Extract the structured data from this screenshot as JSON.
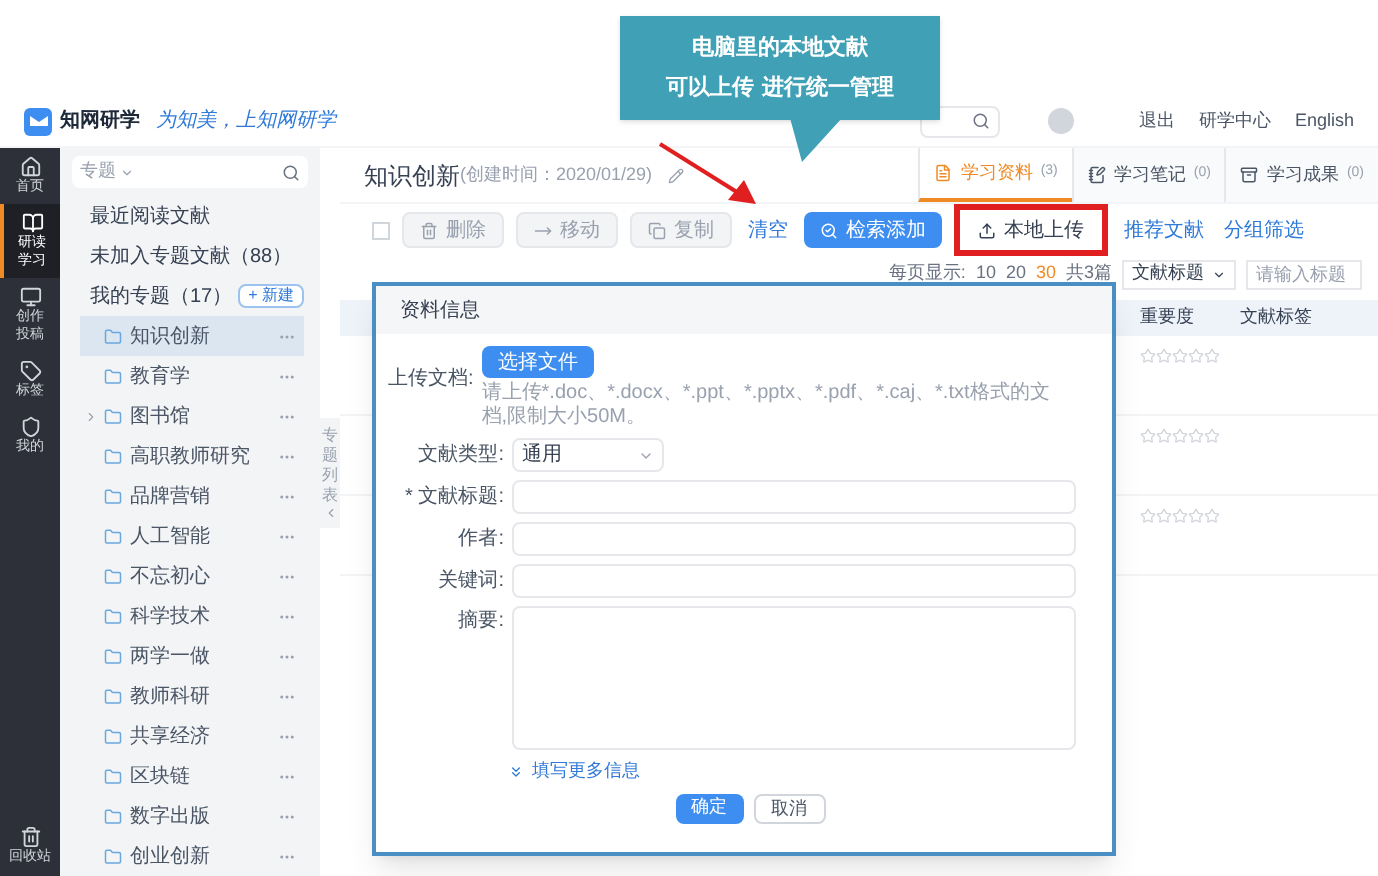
{
  "callout": {
    "lines": [
      "电脑里的本地文献",
      "可以上传 进行统一管理"
    ]
  },
  "topbar": {
    "app_name": "知网研学",
    "slogan": "为知美，上知网研学",
    "links": [
      "退出",
      "研学中心",
      "English"
    ]
  },
  "nav": [
    {
      "label": "首页",
      "selected": false
    },
    {
      "label": "研读学习",
      "selected": true
    },
    {
      "label": "创作投稿",
      "selected": false
    },
    {
      "label": "标签",
      "selected": false
    },
    {
      "label": "我的",
      "selected": false
    }
  ],
  "trash_nav": "回收站",
  "sidebar": {
    "filter": "专题",
    "links": [
      "最近阅读文献",
      "未加入专题文献（88）"
    ],
    "my_topics": "我的专题（17）",
    "new_button": "+ 新建",
    "folders": [
      {
        "label": "知识创新",
        "selected": true,
        "expandable": false
      },
      {
        "label": "教育学",
        "selected": false,
        "expandable": false
      },
      {
        "label": "图书馆",
        "selected": false,
        "expandable": true
      },
      {
        "label": "高职教师研究",
        "selected": false,
        "expandable": false
      },
      {
        "label": "品牌营销",
        "selected": false,
        "expandable": false
      },
      {
        "label": "人工智能",
        "selected": false,
        "expandable": false
      },
      {
        "label": "不忘初心",
        "selected": false,
        "expandable": false
      },
      {
        "label": "科学技术",
        "selected": false,
        "expandable": false
      },
      {
        "label": "两学一做",
        "selected": false,
        "expandable": false
      },
      {
        "label": "教师科研",
        "selected": false,
        "expandable": false
      },
      {
        "label": "共享经济",
        "selected": false,
        "expandable": false
      },
      {
        "label": "区块链",
        "selected": false,
        "expandable": false
      },
      {
        "label": "数字出版",
        "selected": false,
        "expandable": false
      },
      {
        "label": "创业创新",
        "selected": false,
        "expandable": false
      }
    ],
    "collapse_tab": "专题列表"
  },
  "main": {
    "title": "知识创新",
    "created": "(创建时间：2020/01/29)",
    "tabs": [
      {
        "label": "学习资料",
        "count": "(3)",
        "selected": true
      },
      {
        "label": "学习笔记",
        "count": "(0)",
        "selected": false
      },
      {
        "label": "学习成果",
        "count": "(0)",
        "selected": false
      }
    ],
    "select_all_checked": false,
    "toolbar": [
      {
        "kind": "button",
        "label": "删除",
        "disabled": true
      },
      {
        "kind": "button",
        "label": "移动",
        "disabled": true
      },
      {
        "kind": "button",
        "label": "复制",
        "disabled": true
      },
      {
        "kind": "link",
        "label": "清空"
      },
      {
        "kind": "primary",
        "label": "检索添加"
      },
      {
        "kind": "upload",
        "label": "本地上传",
        "highlighted": true
      },
      {
        "kind": "link",
        "label": "推荐文献"
      },
      {
        "kind": "link",
        "label": "分组筛选"
      }
    ],
    "paging": {
      "label": "每页显示:",
      "sizes": [
        {
          "label": "10",
          "selected": false
        },
        {
          "label": "20",
          "selected": false
        },
        {
          "label": "30",
          "selected": true
        }
      ],
      "total": "共3篇",
      "field_select": "文献标题",
      "search": {
        "placeholder": "请输入标题"
      }
    },
    "table": {
      "columns": [
        "重要度",
        "文献标签"
      ],
      "rows": [
        {
          "stars": 0
        },
        {
          "stars": 0
        },
        {
          "stars": 0
        }
      ]
    }
  },
  "dialog": {
    "title": "资料信息",
    "fields": [
      {
        "kind": "file",
        "label": "上传文档:",
        "button": "选择文件",
        "hint": "请上传*.doc、*.docx、*.ppt、*.pptx、*.pdf、*.caj、*.txt格式的文档,限制大小50M。"
      },
      {
        "kind": "select",
        "label": "文献类型:",
        "value": "通用"
      },
      {
        "kind": "input",
        "label": "* 文献标题:"
      },
      {
        "kind": "input",
        "label": "作者:"
      },
      {
        "kind": "input",
        "label": "关键词:"
      },
      {
        "kind": "textarea",
        "label": "摘要:"
      }
    ],
    "more_link": "填写更多信息",
    "buttons": [
      {
        "label": "确定",
        "primary": true
      },
      {
        "label": "取消",
        "primary": false
      }
    ]
  }
}
